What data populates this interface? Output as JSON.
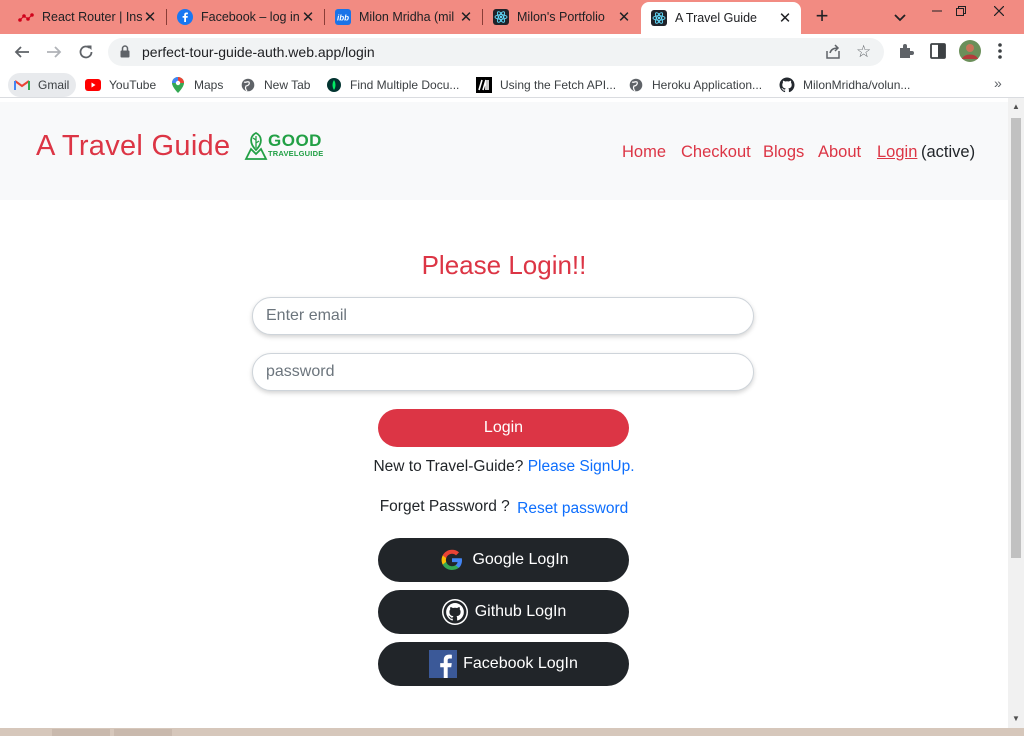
{
  "browser": {
    "tabs": [
      {
        "title": "React Router | Ins",
        "icon": "react-router-icon",
        "active": false
      },
      {
        "title": "Facebook – log in",
        "icon": "facebook-icon",
        "active": false
      },
      {
        "title": "Milon Mridha (mil",
        "icon": "imgbb-icon",
        "active": false
      },
      {
        "title": "Milon's Portfolio",
        "icon": "react-icon",
        "active": false
      },
      {
        "title": "A Travel Guide",
        "icon": "react-icon",
        "active": true
      }
    ],
    "tab_close_glyph": "✕",
    "new_tab_glyph": "+",
    "url": "perfect-tour-guide-auth.web.app/login",
    "bookmarks": [
      {
        "label": "Gmail",
        "icon": "gmail-icon"
      },
      {
        "label": "YouTube",
        "icon": "youtube-icon"
      },
      {
        "label": "Maps",
        "icon": "maps-icon"
      },
      {
        "label": "New Tab",
        "icon": "globe-icon"
      },
      {
        "label": "Find Multiple Docu...",
        "icon": "mongodb-icon"
      },
      {
        "label": "Using the Fetch API...",
        "icon": "mdn-icon"
      },
      {
        "label": "Heroku Application...",
        "icon": "globe-icon"
      },
      {
        "label": "MilonMridha/volun...",
        "icon": "github-icon"
      }
    ],
    "bookmarks_more": "»"
  },
  "site": {
    "brand": "A Travel Guide",
    "logo": {
      "word": "GOOD",
      "sub": "TRAVELGUIDE"
    },
    "nav": [
      {
        "label": "Home"
      },
      {
        "label": "Checkout"
      },
      {
        "label": "Blogs"
      },
      {
        "label": "About"
      },
      {
        "label": "Login"
      }
    ],
    "nav_active_suffix": "(active)"
  },
  "login": {
    "title": "Please Login!!",
    "email_placeholder": "Enter email",
    "password_placeholder": "password",
    "submit_label": "Login",
    "signup_prompt": "New to Travel-Guide?",
    "signup_link": "Please SignUp.",
    "forget_prompt": "Forget Password ?",
    "reset_link": "Reset password",
    "google_label": "Google LogIn",
    "github_label": "Github LogIn",
    "facebook_label": "Facebook LogIn"
  },
  "colors": {
    "tab_strip": "#f28b82",
    "brand_red": "#dc3545",
    "link_blue": "#0d6efd",
    "social_dark": "#212529",
    "header_bg": "#f8f9fa"
  }
}
